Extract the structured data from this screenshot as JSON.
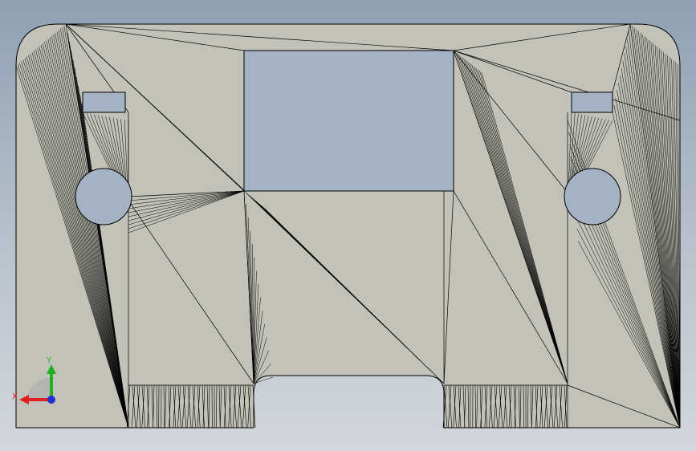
{
  "viewport": {
    "background_top": "#8fa0b4",
    "background_bottom": "#d3d7db"
  },
  "part": {
    "face_color": "#c2c2b8",
    "edge_color": "#000000",
    "hole_color": "#a4b2c3"
  },
  "triad": {
    "x_label": "X",
    "y_label": "Y",
    "x_color": "#e02020",
    "y_color": "#20b020",
    "z_color": "#2030d0",
    "icon": "coordinate-triad-icon"
  }
}
